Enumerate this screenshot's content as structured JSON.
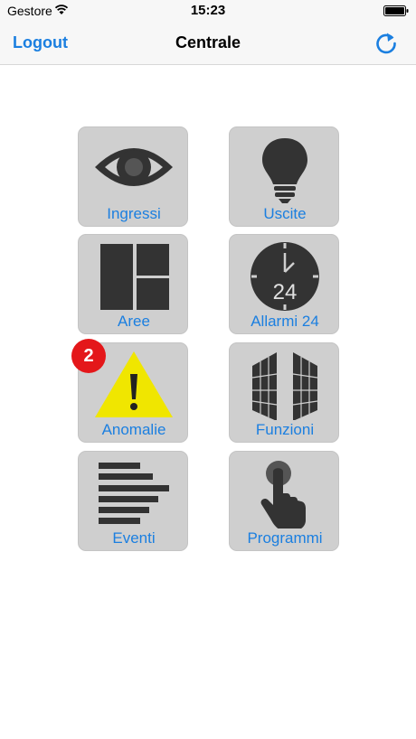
{
  "status_bar": {
    "carrier": "Gestore",
    "time": "15:23"
  },
  "nav": {
    "left_label": "Logout",
    "title": "Centrale",
    "right_icon": "refresh-icon"
  },
  "tiles": [
    {
      "label": "Ingressi",
      "icon": "eye-icon"
    },
    {
      "label": "Uscite",
      "icon": "lightbulb-icon"
    },
    {
      "label": "Aree",
      "icon": "areas-grid-icon"
    },
    {
      "label": "Allarmi 24",
      "icon": "clock-24-icon",
      "icon_text": "24"
    },
    {
      "label": "Anomalie",
      "icon": "warning-icon"
    },
    {
      "label": "Funzioni",
      "icon": "gates-icon"
    },
    {
      "label": "Eventi",
      "icon": "event-list-icon"
    },
    {
      "label": "Programmi",
      "icon": "touch-hand-icon"
    }
  ],
  "anomalie_badge": "2",
  "colors": {
    "accent": "#1b7fe0",
    "tile_bg": "#cfcfcf",
    "icon": "#333333",
    "warning": "#f0e600",
    "badge": "#e4171a"
  }
}
